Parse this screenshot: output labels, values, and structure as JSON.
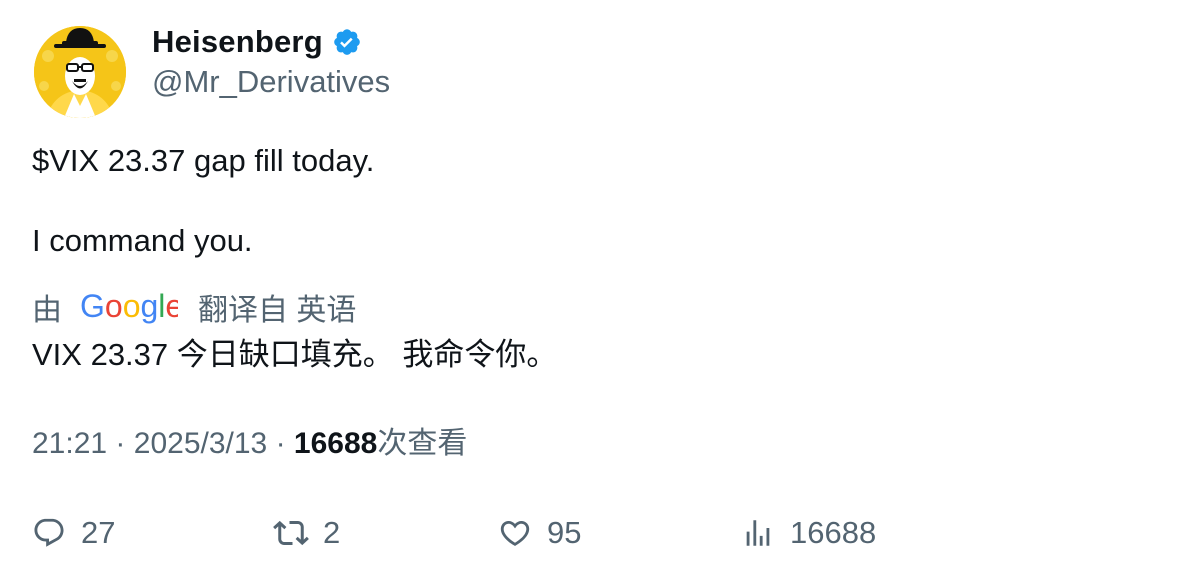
{
  "author": {
    "name": "Heisenberg",
    "handle": "@Mr_Derivatives",
    "verified": true,
    "verified_color": "#1d9bf0"
  },
  "tweet": {
    "lines": [
      "$VIX 23.37 gap fill today.",
      "I command you."
    ]
  },
  "translation": {
    "prefix": "由",
    "provider_logo": "Google",
    "suffix": "翻译自 英语",
    "text": "VIX 23.37 今日缺口填充。 我命令你。"
  },
  "meta": {
    "time": "21:21",
    "separator": "·",
    "date": "2025/3/13",
    "views_count": "16688",
    "views_label": "次查看"
  },
  "actions": {
    "reply_count": "27",
    "retweet_count": "2",
    "like_count": "95",
    "views_count": "16688"
  },
  "colors": {
    "text_primary": "#0f1419",
    "text_secondary": "#536471",
    "avatar_bg": "#f5c518"
  },
  "icons": {
    "reply": "reply-icon",
    "retweet": "retweet-icon",
    "like": "like-icon",
    "views": "views-icon"
  }
}
